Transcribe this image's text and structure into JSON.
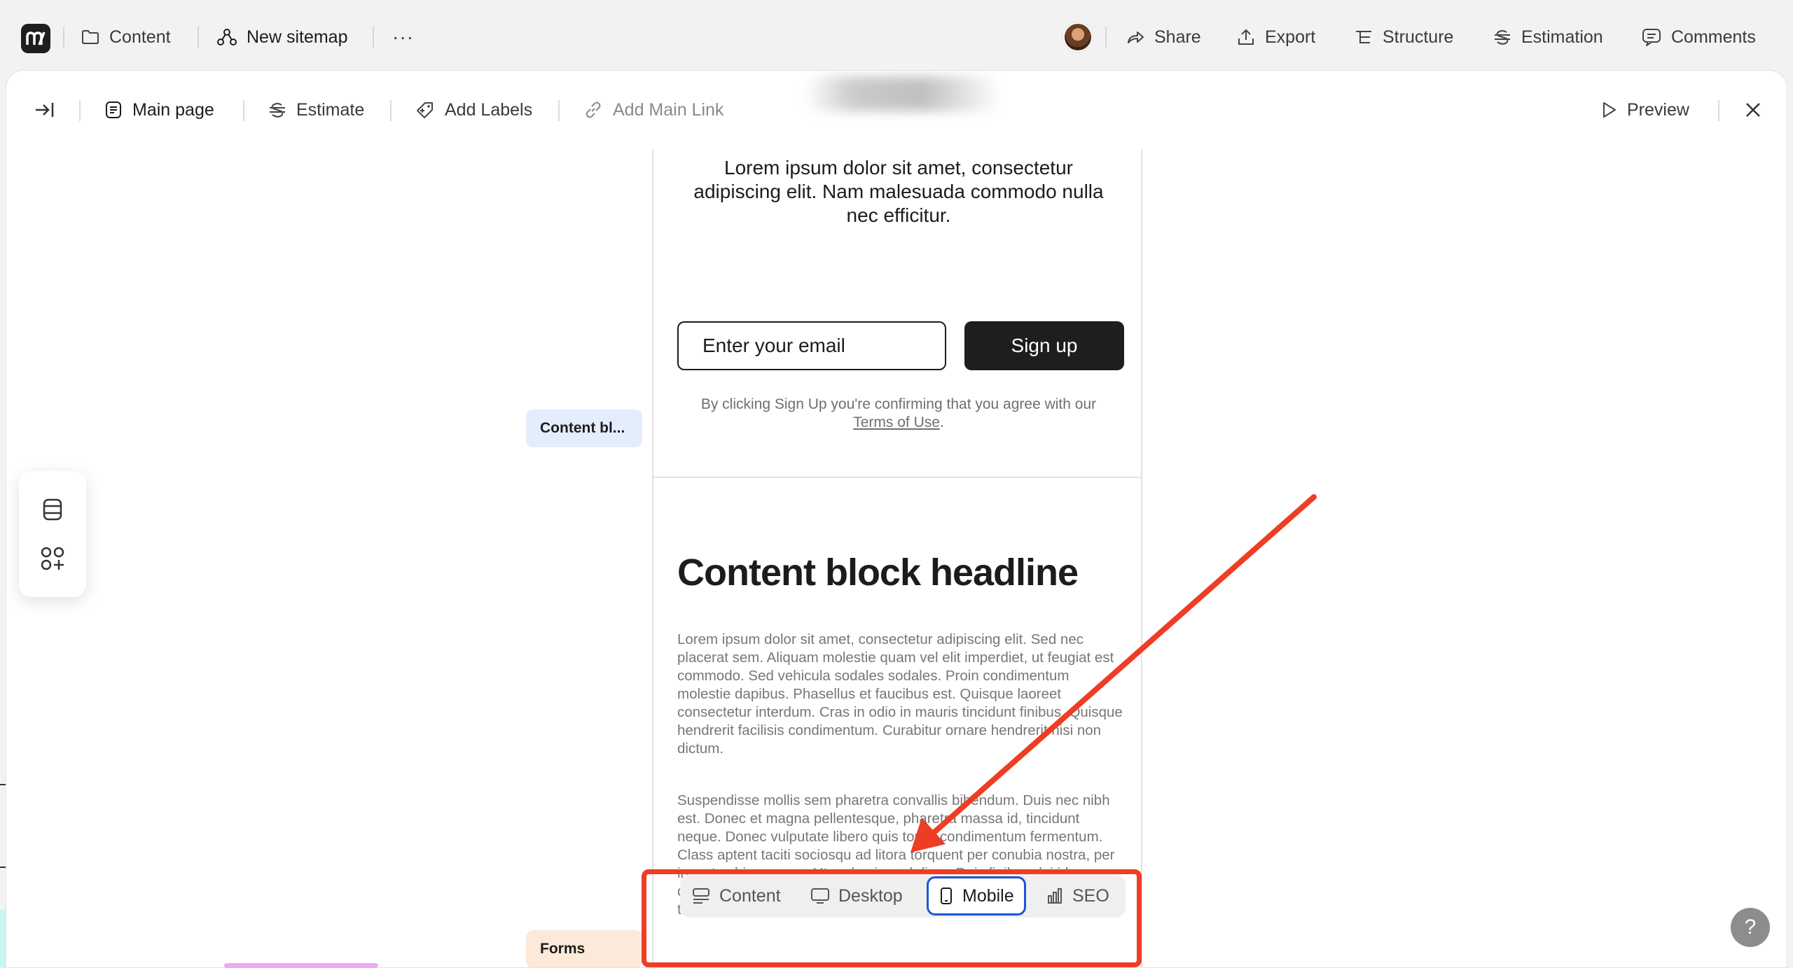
{
  "topbar": {
    "content_label": "Content",
    "sitemap_label": "New sitemap",
    "more_label": "···",
    "share_label": "Share",
    "export_label": "Export",
    "structure_label": "Structure",
    "estimation_label": "Estimation",
    "comments_label": "Comments"
  },
  "subbar": {
    "main_page_label": "Main page",
    "estimate_label": "Estimate",
    "add_labels_label": "Add Labels",
    "add_main_link_label": "Add Main Link",
    "preview_label": "Preview"
  },
  "sections": {
    "content_block_label": "Content bl...",
    "forms_label": "Forms"
  },
  "canvas": {
    "lead_text": "Lorem ipsum dolor sit amet, consectetur adipiscing elit. Nam malesuada commodo nulla nec efficitur.",
    "email_placeholder": "Enter your email",
    "signup_label": "Sign up",
    "terms_prefix": "By clicking Sign Up you're confirming that you agree with our",
    "terms_link": "Terms of Use",
    "terms_suffix": ".",
    "headline": "Content block headline",
    "paragraph_1": "Lorem ipsum dolor sit amet, consectetur adipiscing elit. Sed nec placerat sem. Aliquam molestie quam vel elit imperdiet, ut feugiat est commodo. Sed vehicula sodales sodales. Proin condimentum molestie dapibus. Phasellus et faucibus est. Quisque laoreet consectetur interdum. Cras in odio in mauris tincidunt finibus. Quisque hendrerit facilisis condimentum. Curabitur ornare hendrerit nisi non dictum.",
    "paragraph_2": "Suspendisse mollis sem pharetra convallis bibendum. Duis nec nibh est. Donec et magna pellentesque, pharetra massa id, tincidunt neque. Donec vulputate libero quis tortor condimentum fermentum. Class aptent taciti sociosqu ad litora torquent per conubia nostra, per inceptos himenaeos. Ut sed euismod diam. Duis finibus dui id augue dapibus, in pretium tellus consequat. Nam convallis lacus sit amet turpis lacinia, vitae rhoncus nisi ornare."
  },
  "view_switch": {
    "items": [
      "Content",
      "Desktop",
      "Mobile",
      "SEO"
    ],
    "active": "Mobile"
  },
  "help_label": "?",
  "colors": {
    "accent_blue": "#1a56db",
    "annotation_red": "#ee3d25",
    "section_blue": "#e4edfb",
    "section_peach": "#fde9d9"
  }
}
